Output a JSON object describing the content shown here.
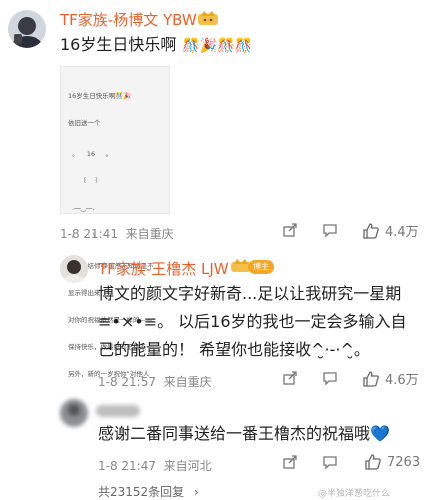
{
  "comment1": {
    "username": "TF家族-杨博文 YBW",
    "text": "16岁生日快乐啊",
    "emojis": "🎊🎉🎊🎊",
    "time": "1-8 21:41",
    "location": "来自重庆",
    "likes": "4.4万"
  },
  "image_post": {
    "lines": [
      "16岁生日快乐啊🎊🎉",
      "依旧送一个",
      "  。    16     。",
      "       ꒰   ꒱",
      "  .⎯⎯‿⎯⎯.",
      "  /         \\",
      "大重联结你😂虽然不知道显不",
      "显示得出来",
      "对你的祝福依然是一样的——",
      "保持快乐，做最好的王橹杰～",
      "另外，新的一岁祝你“对他人"
    ]
  },
  "comment2": {
    "username": "TF家族-王橹杰 LJW",
    "badge": "博主",
    "text_lines": [
      "博文的颜文字好新奇...足以让我研究一星期",
      "≡•×•≡。 以后16岁的我也一定会多输入自",
      "己的能量的！ 希望你也能接收^̮·-·^̮。"
    ],
    "time": "1-8 21:57",
    "location": "来自重庆",
    "likes": "4.6万"
  },
  "comment3": {
    "text": "感谢二番同事送给一番王橹杰的祝福哦",
    "emoji": "💙",
    "time": "1-8 21:47",
    "location": "来自河北",
    "likes": "7263"
  },
  "replies": {
    "label": "共23152条回复",
    "chevron": "›"
  },
  "watermark": "@半独洋葱吃什么"
}
